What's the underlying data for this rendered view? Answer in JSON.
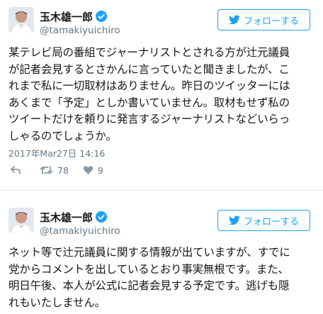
{
  "tweets": [
    {
      "display_name": "玉木雄一郎",
      "handle": "@tamakiyuichiro",
      "follow_label": "フォローする",
      "text": "某テレビ局の番組でジャーナリストとされる方が辻元議員\nが記者会見するとさかんに言っていたと聞きましたが、こ\nれまで私に一切取材はありません。昨日のツイッターには\nあくまで「予定」としか書いていません。取材もせず私の\nツイートだけを頼りに発言するジャーナリストなどいらっ\nしゃるのでしょうか。",
      "timestamp": "2017年Mar27日 14:16",
      "retweet_count": "78",
      "like_count": "9"
    },
    {
      "display_name": "玉木雄一郎",
      "handle": "@tamakiyuichiro",
      "follow_label": "フォローする",
      "text": "ネット等で辻元議員に関する情報が出ていますが、すでに\n党からコメントを出しているとおり事実無根です。また、\n明日午後、本人が公式に記者会見する予定です。逃げも隠\nれもいたしません。"
    }
  ],
  "icons": {
    "verified": "verified-badge-icon",
    "follow": "twitter-bird-icon",
    "reply": "reply-arrow-icon",
    "retweet": "retweet-icon",
    "like": "heart-icon"
  },
  "colors": {
    "brand_blue": "#1da1f2",
    "text": "#14171a",
    "muted": "#657786",
    "divider": "#e1e8ed"
  }
}
